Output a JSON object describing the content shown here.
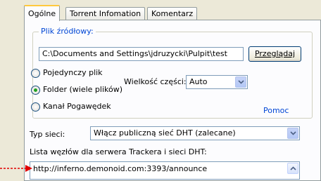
{
  "tabs": [
    {
      "label": "Ogólne",
      "active": true
    },
    {
      "label": "Torrent Infomation",
      "active": false
    },
    {
      "label": "Komentarz",
      "active": false
    }
  ],
  "source": {
    "group_label": "Plik źródłowy:",
    "path_value": "C:\\Documents and Settings\\jdruzycki\\Pulpit\\test",
    "browse_label": "Przeglądaj"
  },
  "mode": {
    "single_label": "Pojedynczy plik",
    "folder_label": "Folder (wiele plików)",
    "chat_label": "Kanał Pogawędek",
    "selected": "folder"
  },
  "piece_size": {
    "label": "Wielkość części:",
    "value": "Auto"
  },
  "help_label": "Pomoc",
  "network": {
    "label": "Typ sieci:",
    "value": "Włącz publiczną sieć DHT (zalecane)"
  },
  "nodes": {
    "label": "Lista węzłów dla serwera Trackera i sieci DHT:",
    "value": "http://inferno.demonoid.com:3393/announce"
  },
  "colors": {
    "accent": "#0046d5",
    "annotation_arrow": "#e00000"
  }
}
